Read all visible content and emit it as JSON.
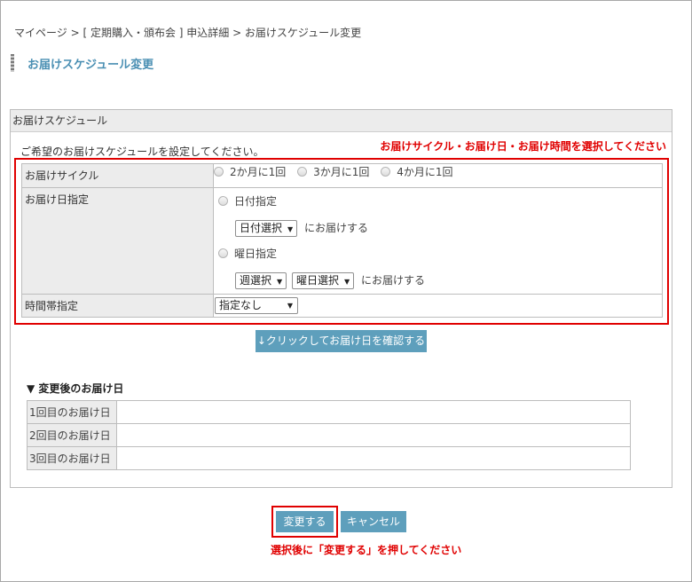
{
  "breadcrumb": {
    "text": "マイページ > [ 定期購入・頒布会 ] 申込詳細 > お届けスケジュール変更"
  },
  "page": {
    "title": "お届けスケジュール変更"
  },
  "schedule": {
    "header": "お届けスケジュール",
    "description": "ご希望のお届けスケジュールを設定してください。",
    "instruction": "お届けサイクル・お届け日・お届け時間を選択してください",
    "cycle": {
      "label": "お届けサイクル",
      "options": [
        "2か月に1回",
        "3か月に1回",
        "4か月に1回"
      ]
    },
    "date": {
      "label": "お届け日指定",
      "date_option": "日付指定",
      "date_select": "日付選択",
      "deliver_text": "にお届けする",
      "weekday_option": "曜日指定",
      "week_select": "週選択",
      "weekday_select": "曜日選択",
      "deliver_text2": "にお届けする"
    },
    "time": {
      "label": "時間帯指定",
      "select": "指定なし"
    }
  },
  "confirm_button": "↓クリックしてお届け日を確認する",
  "after": {
    "heading": "▼ 変更後のお届け日",
    "rows": [
      {
        "label": "1回目のお届け日",
        "value": ""
      },
      {
        "label": "2回目のお届け日",
        "value": ""
      },
      {
        "label": "3回目のお届け日",
        "value": ""
      }
    ]
  },
  "actions": {
    "submit": "変更する",
    "cancel": "キャンセル",
    "note": "選択後に「変更する」を押してください"
  },
  "colors": {
    "accent": "#5e9fbc",
    "title": "#4a8fb3",
    "highlight": "#e00000"
  },
  "icons": {
    "select_arrow": "chevron-down-icon",
    "title_bar": "title-bar-icon"
  }
}
